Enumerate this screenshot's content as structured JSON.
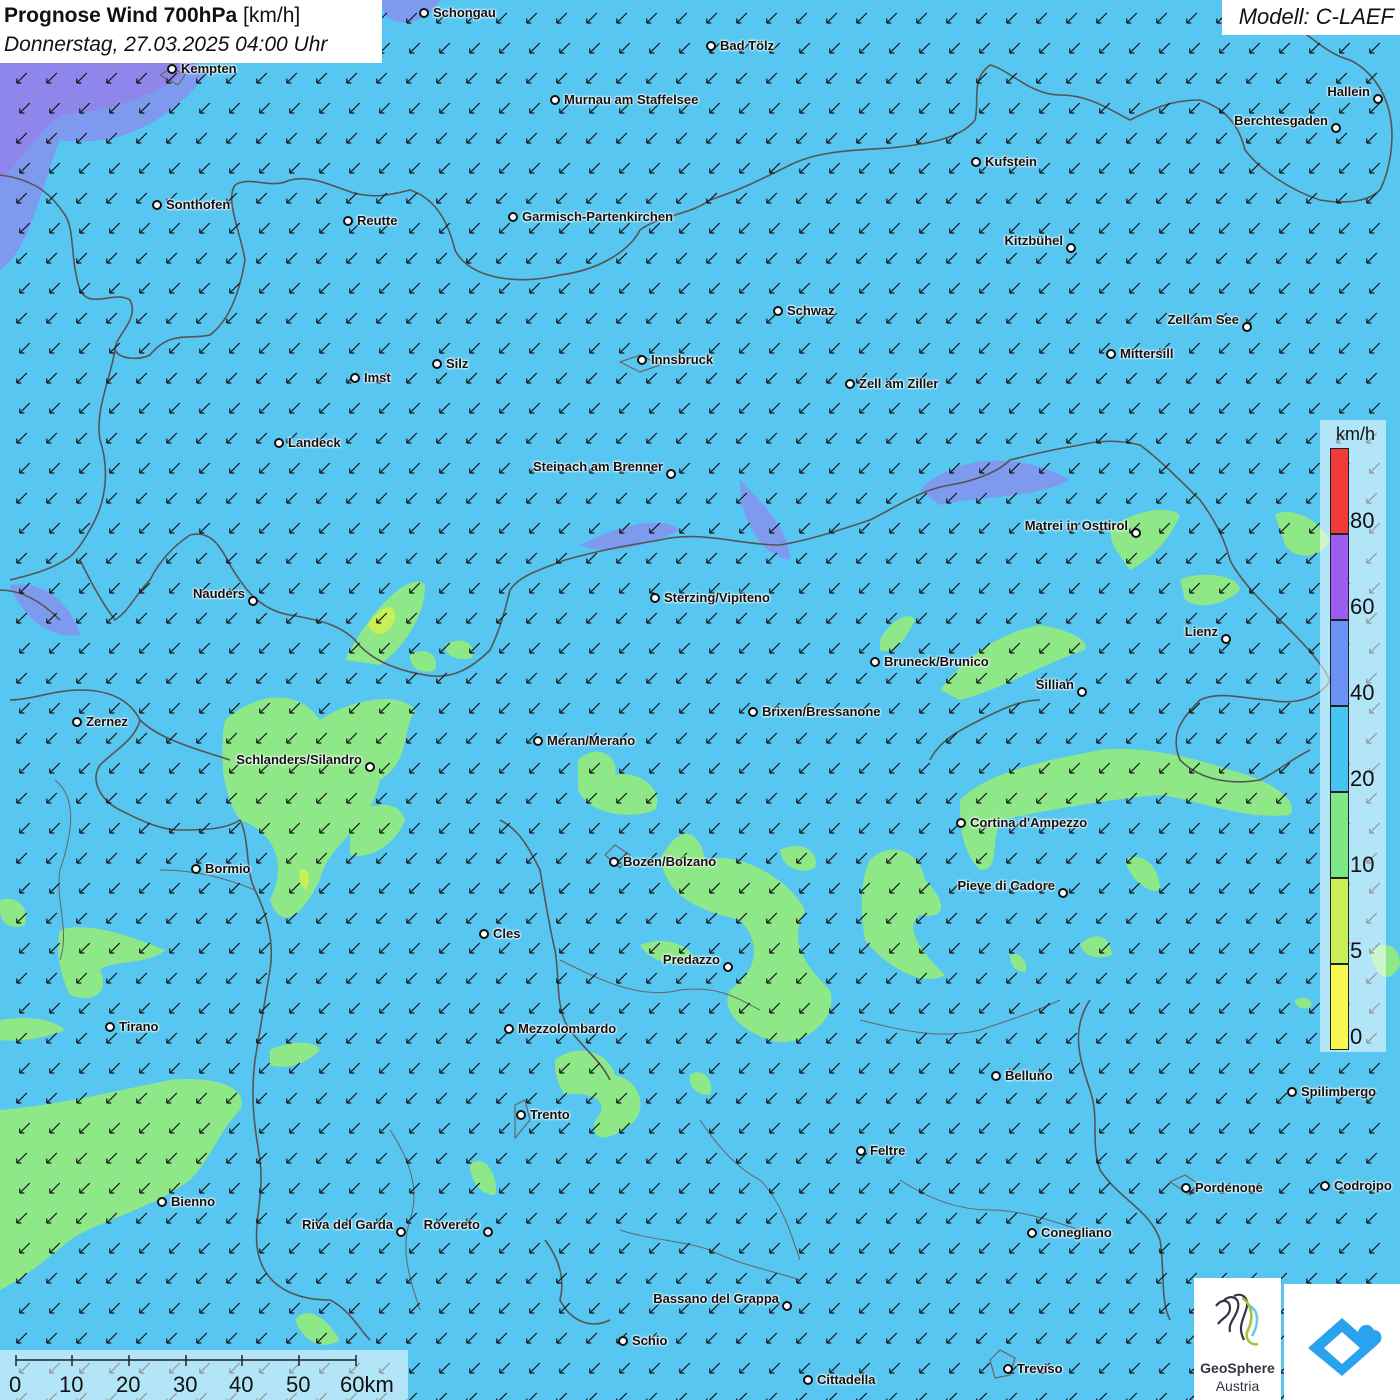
{
  "header": {
    "title_bold": "Prognose Wind 700hPa",
    "title_unit": "[km/h]",
    "date": "Donnerstag, 27.03.2025 04:00 Uhr",
    "model": "Modell: C-LAEF"
  },
  "legend": {
    "unit": "km/h",
    "labels": [
      "80",
      "60",
      "40",
      "20",
      "10",
      "5",
      "0"
    ],
    "segment_colors": [
      "#f23a3a",
      "#9b5ef0",
      "#6a93f5",
      "#46c4f2",
      "#7ee887",
      "#c8f056",
      "#f8f84e"
    ]
  },
  "scale_bar": {
    "labels": [
      "0",
      "10",
      "20",
      "30",
      "40",
      "50",
      "60km"
    ]
  },
  "colors": {
    "base_10_20": "#57c6f0",
    "band_5_10": "#8fe888",
    "band_20_40": "#6aa8f4",
    "band_40_60": "#8e86ea",
    "border": "#555555"
  },
  "wind": {
    "direction": "north-east to south-west"
  },
  "cities": [
    {
      "name": "Schongau"
    },
    {
      "name": "Bad Tölz"
    },
    {
      "name": "Kempten"
    },
    {
      "name": "Murnau am Staffelsee"
    },
    {
      "name": "Hallein"
    },
    {
      "name": "Berchtesgaden"
    },
    {
      "name": "Kufstein"
    },
    {
      "name": "Sonthofen"
    },
    {
      "name": "Reutte"
    },
    {
      "name": "Garmisch-Partenkirchen"
    },
    {
      "name": "Kitzbühel"
    },
    {
      "name": "Schwaz"
    },
    {
      "name": "Zell am See"
    },
    {
      "name": "Mittersill"
    },
    {
      "name": "Silz"
    },
    {
      "name": "Innsbruck"
    },
    {
      "name": "Imst"
    },
    {
      "name": "Zell am Ziller"
    },
    {
      "name": "Landeck"
    },
    {
      "name": "Steinach am Brenner"
    },
    {
      "name": "Matrei in Osttirol"
    },
    {
      "name": "Nauders"
    },
    {
      "name": "Sterzing/Vipiteno"
    },
    {
      "name": "Lienz"
    },
    {
      "name": "Bruneck/Brunico"
    },
    {
      "name": "Sillian"
    },
    {
      "name": "Zernez"
    },
    {
      "name": "Brixen/Bressanone"
    },
    {
      "name": "Meran/Merano"
    },
    {
      "name": "Schlanders/Silandro"
    },
    {
      "name": "Cortina d'Ampezzo"
    },
    {
      "name": "Bormio"
    },
    {
      "name": "Bozen/Bolzano"
    },
    {
      "name": "Pieve di Cadore"
    },
    {
      "name": "Cles"
    },
    {
      "name": "Predazzo"
    },
    {
      "name": "Tirano"
    },
    {
      "name": "Mezzolombardo"
    },
    {
      "name": "Belluno"
    },
    {
      "name": "Spilimbergo"
    },
    {
      "name": "Trento"
    },
    {
      "name": "Feltre"
    },
    {
      "name": "Pordenone"
    },
    {
      "name": "Codroipo"
    },
    {
      "name": "Bienno"
    },
    {
      "name": "Riva del Garda"
    },
    {
      "name": "Rovereto"
    },
    {
      "name": "Conegliano"
    },
    {
      "name": "Bassano del Grappa"
    },
    {
      "name": "Schio"
    },
    {
      "name": "Treviso"
    },
    {
      "name": "Cittadella"
    }
  ],
  "logos": {
    "geosphere_name": "GeoSphere",
    "geosphere_country": "Austria"
  }
}
